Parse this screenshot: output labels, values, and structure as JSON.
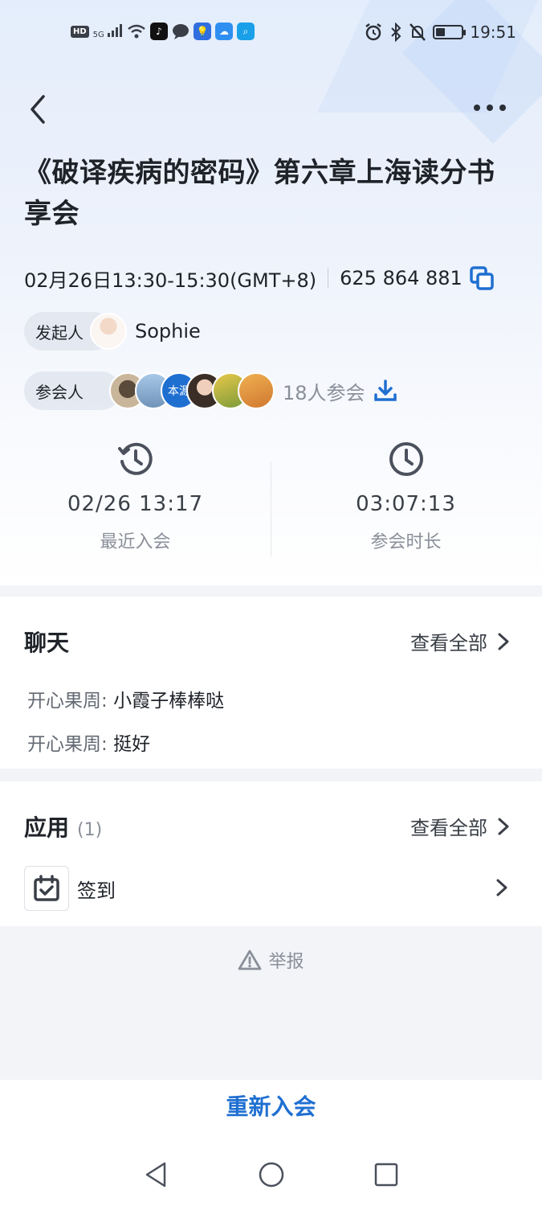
{
  "status_bar": {
    "time": "19:51",
    "hd": "HD",
    "signal": "5G",
    "battery_level": 0.35
  },
  "header": {
    "title": "《破译疾病的密码》第六章上海读分书享会"
  },
  "meeting": {
    "time_range": "02月26日13:30-15:30(GMT+8)",
    "meeting_id": "625 864 881"
  },
  "organizer": {
    "label": "发起人",
    "name": "Sophie"
  },
  "attendees": {
    "label": "参会人",
    "avatar_text": "本源",
    "count_text": "18人参会"
  },
  "stats": {
    "recent_join_value": "02/26 13:17",
    "recent_join_label": "最近入会",
    "duration_value": "03:07:13",
    "duration_label": "参会时长"
  },
  "chat": {
    "title": "聊天",
    "view_all": "查看全部",
    "messages": [
      {
        "sender": "开心果周:",
        "text": "小霞子棒棒哒"
      },
      {
        "sender": "开心果周:",
        "text": "挺好"
      }
    ]
  },
  "apps": {
    "title": "应用",
    "count": "(1)",
    "view_all": "查看全部",
    "items": [
      {
        "name": "签到"
      }
    ]
  },
  "report": {
    "label": "举报"
  },
  "actions": {
    "rejoin": "重新入会"
  },
  "colors": {
    "accent": "#1f6fd1",
    "text": "#1f2329",
    "muted": "#8a8f99"
  }
}
